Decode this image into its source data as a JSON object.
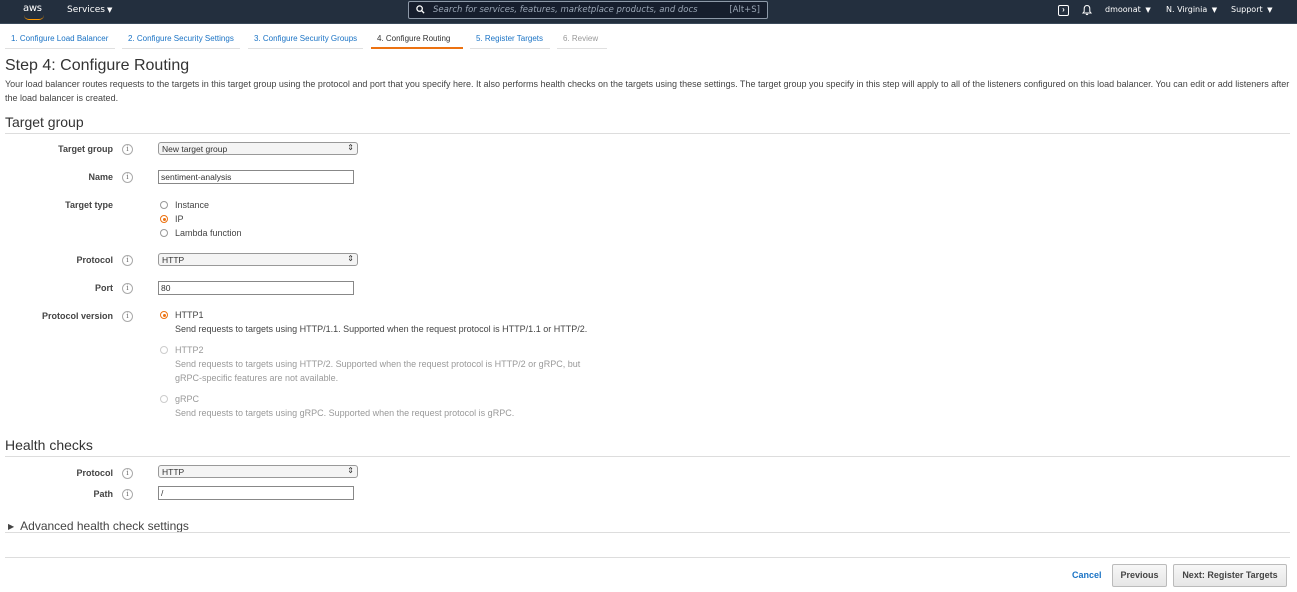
{
  "topnav": {
    "logo": "aws",
    "services_label": "Services",
    "search_placeholder": "Search for services, features, marketplace products, and docs",
    "search_shortcut": "[Alt+S]",
    "user": "dmoonat",
    "region": "N. Virginia",
    "support": "Support"
  },
  "wizard_tabs": [
    {
      "label": "1. Configure Load Balancer",
      "state": "link"
    },
    {
      "label": "2. Configure Security Settings",
      "state": "link"
    },
    {
      "label": "3. Configure Security Groups",
      "state": "link"
    },
    {
      "label": "4. Configure Routing",
      "state": "active"
    },
    {
      "label": "5. Register Targets",
      "state": "link"
    },
    {
      "label": "6. Review",
      "state": "disabled"
    }
  ],
  "page": {
    "title": "Step 4: Configure Routing",
    "description": "Your load balancer routes requests to the targets in this target group using the protocol and port that you specify here. It also performs health checks on the targets using these settings. The target group you specify in this step will apply to all of the listeners configured on this load balancer. You can edit or add listeners after the load balancer is created."
  },
  "target_group": {
    "heading": "Target group",
    "target_group_label": "Target group",
    "target_group_value": "New target group",
    "name_label": "Name",
    "name_value": "sentiment-analysis",
    "target_type_label": "Target type",
    "target_types": [
      {
        "label": "Instance",
        "checked": false
      },
      {
        "label": "IP",
        "checked": true
      },
      {
        "label": "Lambda function",
        "checked": false
      }
    ],
    "protocol_label": "Protocol",
    "protocol_value": "HTTP",
    "port_label": "Port",
    "port_value": "80",
    "protocol_version_label": "Protocol version",
    "protocol_versions": [
      {
        "label": "HTTP1",
        "checked": true,
        "disabled": false,
        "desc": "Send requests to targets using HTTP/1.1. Supported when the request protocol is HTTP/1.1 or HTTP/2."
      },
      {
        "label": "HTTP2",
        "checked": false,
        "disabled": true,
        "desc": "Send requests to targets using HTTP/2. Supported when the request protocol is HTTP/2 or gRPC, but gRPC-specific features are not available."
      },
      {
        "label": "gRPC",
        "checked": false,
        "disabled": true,
        "desc": "Send requests to targets using gRPC. Supported when the request protocol is gRPC."
      }
    ]
  },
  "health_checks": {
    "heading": "Health checks",
    "protocol_label": "Protocol",
    "protocol_value": "HTTP",
    "path_label": "Path",
    "path_value": "/",
    "advanced_label": "Advanced health check settings"
  },
  "footer": {
    "cancel": "Cancel",
    "previous": "Previous",
    "next": "Next: Register Targets"
  },
  "colors": {
    "nav_bg": "#232f3e",
    "accent": "#ec7211",
    "link": "#1a73c5"
  }
}
